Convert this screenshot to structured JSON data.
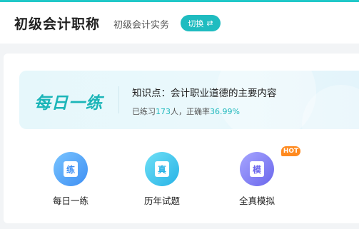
{
  "header": {
    "title": "初级会计职称",
    "subject": "初级会计实务",
    "switch_label": "切换",
    "switch_icon": "swap-arrows-icon"
  },
  "banner": {
    "logo_text": "每日一练",
    "knowledge_point": "知识点：会计职业道德的主要内容",
    "stats_prefix": "已练习",
    "practiced_count": "173",
    "stats_middle": "人，正确率",
    "accuracy": "36.99%"
  },
  "entries": [
    {
      "label": "每日一练",
      "icon_char": "练"
    },
    {
      "label": "历年试题",
      "icon_char": "真"
    },
    {
      "label": "全真模拟",
      "icon_char": "模",
      "badge": "HOT"
    }
  ],
  "colors": {
    "accent": "#1fbcc0",
    "hot": "#ff8a1f",
    "title": "#1f1f1f"
  }
}
